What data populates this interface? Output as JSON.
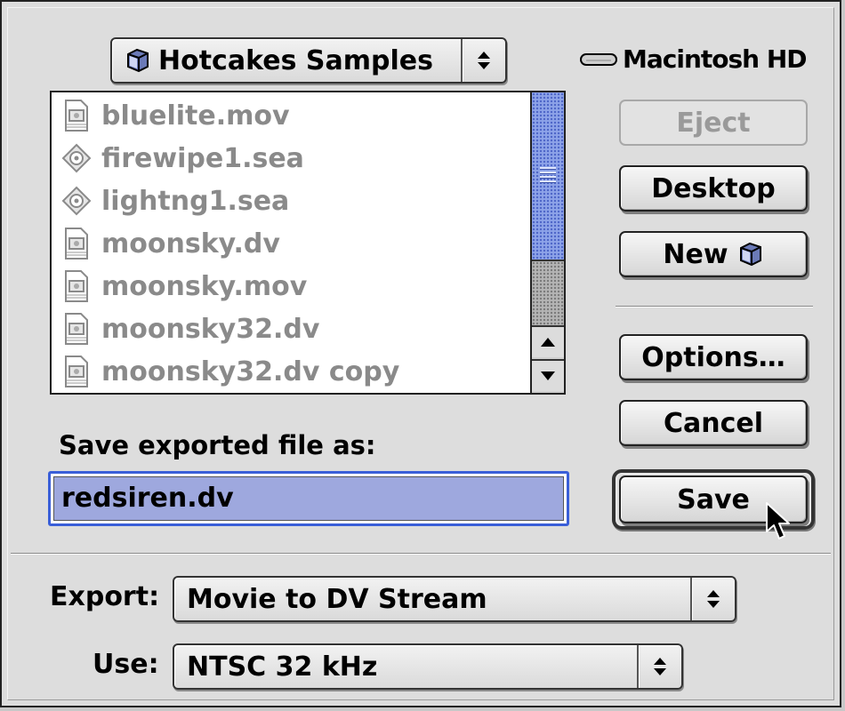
{
  "folder_popup": {
    "label": "Hotcakes Samples",
    "icon": "folder-icon"
  },
  "volume": {
    "label": "Macintosh HD",
    "icon": "hard-drive-icon"
  },
  "files": [
    {
      "name": "bluelite.mov",
      "icon": "movie-file-icon"
    },
    {
      "name": "firewipe1.sea",
      "icon": "archive-file-icon"
    },
    {
      "name": "lightng1.sea",
      "icon": "archive-file-icon"
    },
    {
      "name": "moonsky.dv",
      "icon": "movie-file-icon"
    },
    {
      "name": "moonsky.mov",
      "icon": "movie-file-icon"
    },
    {
      "name": "moonsky32.dv",
      "icon": "movie-file-icon"
    },
    {
      "name": "moonsky32.dv copy",
      "icon": "movie-file-icon"
    }
  ],
  "buttons": {
    "eject": "Eject",
    "desktop": "Desktop",
    "new": "New",
    "options": "Options…",
    "cancel": "Cancel",
    "save": "Save"
  },
  "save_prompt": "Save exported file as:",
  "filename_value": "redsiren.dv",
  "export": {
    "label": "Export:",
    "value": "Movie to DV Stream"
  },
  "use": {
    "label": "Use:",
    "value": "NTSC 32 kHz"
  },
  "colors": {
    "scroll_thumb": "#8da3e8",
    "focus_ring": "#3a5fd8",
    "selection": "#9ea8de"
  }
}
